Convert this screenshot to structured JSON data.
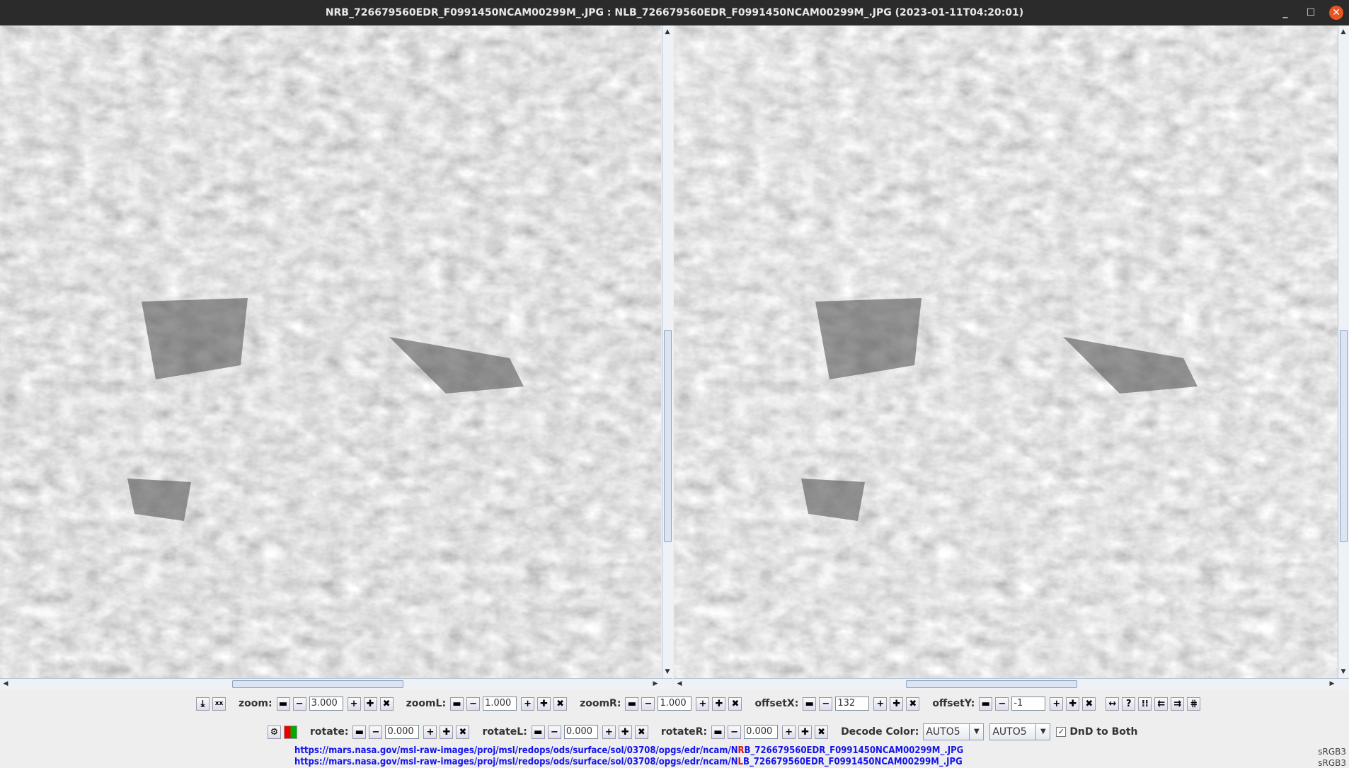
{
  "window": {
    "title": "NRB_726679560EDR_F0991450NCAM00299M_.JPG : NLB_726679560EDR_F0991450NCAM00299M_.JPG (2023-01-11T04:20:01)",
    "minimize": "_",
    "maximize": "☐",
    "close": "✕"
  },
  "toolbar1": {
    "save_icon": "⤓",
    "xx_label": "xx",
    "groups": [
      {
        "id": "zoom",
        "label": "zoom:",
        "value": "3.000"
      },
      {
        "id": "zoomL",
        "label": "zoomL:",
        "value": "1.000"
      },
      {
        "id": "zoomR",
        "label": "zoomR:",
        "value": "1.000"
      },
      {
        "id": "offsetX",
        "label": "offsetX:",
        "value": "132"
      },
      {
        "id": "offsetY",
        "label": "offsetY:",
        "value": "-1"
      }
    ],
    "extra_icons": [
      {
        "name": "swap-horizontal-icon",
        "glyph": "↔"
      },
      {
        "name": "help-icon",
        "glyph": "?"
      },
      {
        "name": "align-grid-icon",
        "glyph": "⁞⁞"
      },
      {
        "name": "align-left-icon",
        "glyph": "⇇"
      },
      {
        "name": "align-right-icon",
        "glyph": "⇉"
      },
      {
        "name": "align-both-icon",
        "glyph": "⋕"
      }
    ]
  },
  "toolbar2": {
    "settings_icon": "⚙",
    "groups": [
      {
        "id": "rotate",
        "label": "rotate:",
        "value": "0.000"
      },
      {
        "id": "rotateL",
        "label": "rotateL:",
        "value": "0.000"
      },
      {
        "id": "rotateR",
        "label": "rotateR:",
        "value": "0.000"
      }
    ],
    "decode_label": "Decode Color:",
    "decode_left": "AUTO5",
    "decode_right": "AUTO5",
    "dnd_label": "DnD to Both",
    "dnd_checked": true
  },
  "buttons": {
    "big_minus": "▬",
    "minus": "−",
    "plus": "+",
    "big_plus": "✚",
    "reset": "✖"
  },
  "urls": [
    {
      "prefix": "https://mars.nasa.gov/msl-raw-images/proj/msl/redops/ods/surface/sol/03708/opgs/edr/ncam/N",
      "hl": "R",
      "suffix": "B_726679560EDR_F0991450NCAM00299M_.JPG",
      "profile": "sRGB3"
    },
    {
      "prefix": "https://mars.nasa.gov/msl-raw-images/proj/msl/redops/ods/surface/sol/03708/opgs/edr/ncam/N",
      "hl": "L",
      "suffix": "B_726679560EDR_F0991450NCAM00299M_.JPG",
      "profile": "sRGB3"
    }
  ]
}
